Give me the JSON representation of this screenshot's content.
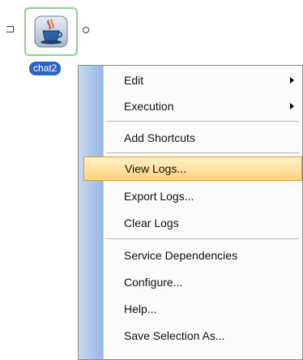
{
  "node": {
    "label": "chat2",
    "icon": "java-coffee-cup-icon",
    "border_color": "#8bd18a",
    "label_color": "#2e63c8"
  },
  "menu": {
    "items": [
      {
        "label": "Edit",
        "has_submenu": true
      },
      {
        "label": "Execution",
        "has_submenu": true
      },
      {
        "label": "Add Shortcuts"
      },
      {
        "label": "View Logs...",
        "highlighted": true
      },
      {
        "label": "Export Logs..."
      },
      {
        "label": "Clear Logs"
      },
      {
        "label": "Service Dependencies"
      },
      {
        "label": "Configure..."
      },
      {
        "label": "Help..."
      },
      {
        "label": "Save Selection As..."
      }
    ],
    "highlight_color": "#ffd37a",
    "gutter_color": "#a9c4ea"
  }
}
